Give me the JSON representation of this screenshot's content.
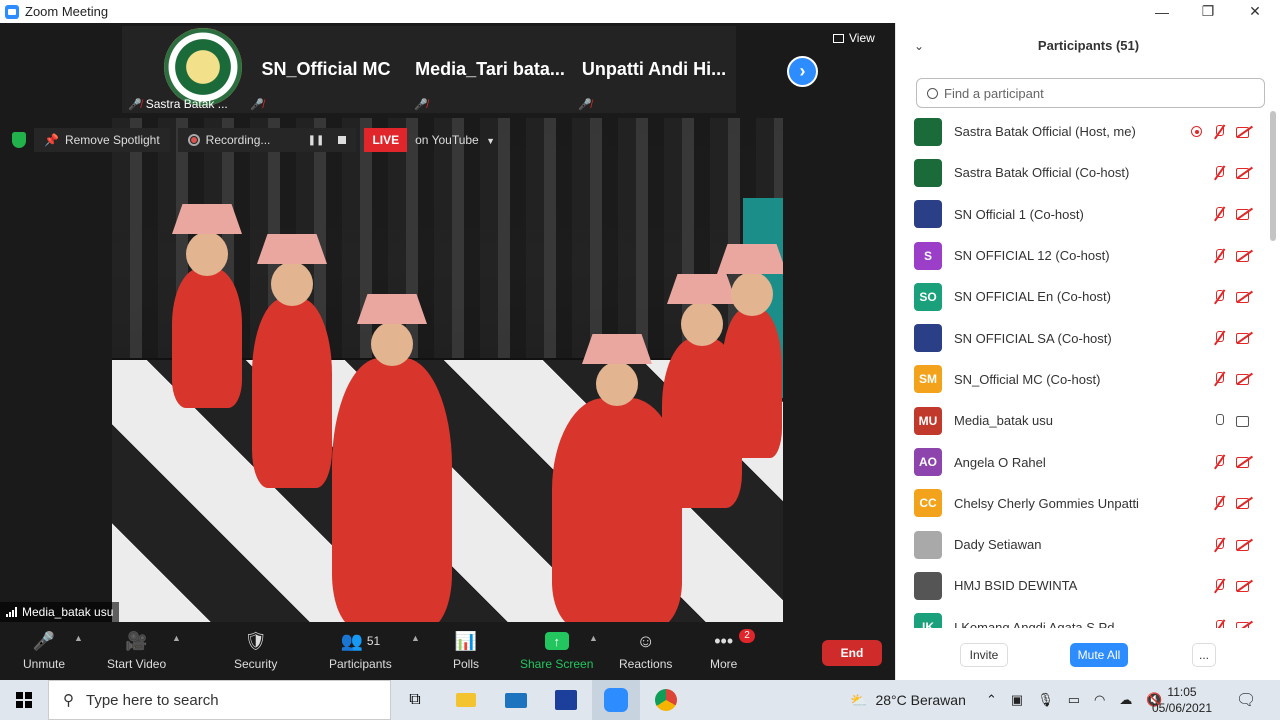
{
  "window": {
    "title": "Zoom Meeting",
    "minimize": "—",
    "maximize": "❐",
    "close": "✕"
  },
  "view_button": {
    "label": "View"
  },
  "thumbnails": [
    {
      "name": "Sastra Batak ...",
      "display": ""
    },
    {
      "name": "",
      "display": "SN_Official MC"
    },
    {
      "name": "",
      "display": "Media_Tari  bata..."
    },
    {
      "name": "",
      "display": "Unpatti Andi Hi..."
    }
  ],
  "overlay": {
    "remove_spotlight": "Remove Spotlight",
    "recording": "Recording...",
    "live": "LIVE",
    "live_target": "on YouTube"
  },
  "active_speaker": "Media_batak usu",
  "toolbar": {
    "unmute": "Unmute",
    "start_video": "Start Video",
    "security": "Security",
    "participants": "Participants",
    "participants_count": "51",
    "polls": "Polls",
    "share_screen": "Share Screen",
    "reactions": "Reactions",
    "more": "More",
    "more_badge": "2",
    "end": "End"
  },
  "panel": {
    "title": "Participants (51)",
    "search_placeholder": "Find a participant",
    "invite": "Invite",
    "mute_all": "Mute All",
    "more": "...",
    "participants": [
      {
        "name": "Sastra Batak Official (Host, me)",
        "initials": "",
        "color": "#1b6b3a",
        "mic": "off",
        "cam": "off",
        "recording": true
      },
      {
        "name": "Sastra Batak Official (Co-host)",
        "initials": "",
        "color": "#1b6b3a",
        "mic": "off",
        "cam": "off"
      },
      {
        "name": "SN Official 1 (Co-host)",
        "initials": "",
        "color": "#2b3f86",
        "mic": "off",
        "cam": "off"
      },
      {
        "name": "SN OFFICIAL 12 (Co-host)",
        "initials": "S",
        "color": "#9b3fc9",
        "mic": "off",
        "cam": "off"
      },
      {
        "name": "SN OFFICIAL En (Co-host)",
        "initials": "SO",
        "color": "#1aa07a",
        "mic": "off",
        "cam": "off"
      },
      {
        "name": "SN OFFICIAL SA (Co-host)",
        "initials": "",
        "color": "#2b3f86",
        "mic": "off",
        "cam": "off"
      },
      {
        "name": "SN_Official MC (Co-host)",
        "initials": "SM",
        "color": "#f2a31b",
        "mic": "off",
        "cam": "off"
      },
      {
        "name": "Media_batak usu",
        "initials": "MU",
        "color": "#c0392b",
        "mic": "on",
        "cam": "on"
      },
      {
        "name": "Angela O Rahel",
        "initials": "AO",
        "color": "#8e44ad",
        "mic": "off",
        "cam": "off"
      },
      {
        "name": "Chelsy Cherly Gommies Unpatti",
        "initials": "CC",
        "color": "#f2a31b",
        "mic": "off",
        "cam": "off"
      },
      {
        "name": "Dady Setiawan",
        "initials": "",
        "color": "#a9a9a9",
        "mic": "off",
        "cam": "off"
      },
      {
        "name": "HMJ BSID DEWINTA",
        "initials": "",
        "color": "#555555",
        "mic": "off",
        "cam": "off"
      },
      {
        "name": "I Komang Angdi Agata S.Pd",
        "initials": "IK",
        "color": "#1aa07a",
        "mic": "off",
        "cam": "off"
      }
    ]
  },
  "taskbar": {
    "search_placeholder": "Type here to search",
    "weather": "28°C  Berawan",
    "time": "11:05",
    "date": "05/06/2021"
  },
  "colors": {
    "zoom_blue": "#2d8cff",
    "live_red": "#e0252b",
    "end_red": "#cf2b2b",
    "share_green": "#22c55e"
  }
}
